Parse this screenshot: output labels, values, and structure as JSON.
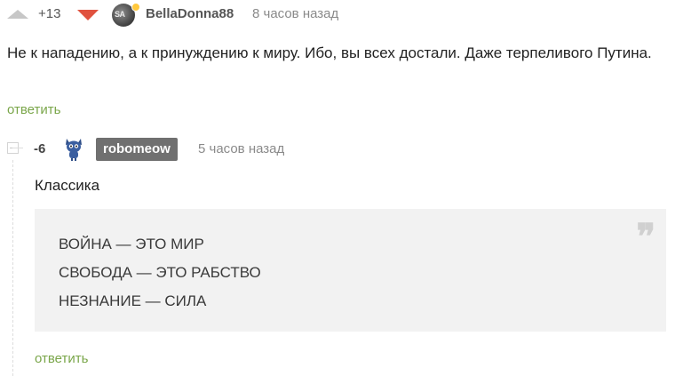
{
  "comment_1": {
    "rating": "+13",
    "username": "BellaDonna88",
    "avatar_text": "SA",
    "time": "8 часов назад",
    "text": "Не к нападению, а к принуждению к миру. Ибо, вы всех достали. Даже терпеливого Путина.",
    "reply_label": "ответить",
    "icons": {
      "upvote": "triangle-up-icon",
      "downvote": "triangle-down-icon"
    },
    "colors": {
      "downvote": "#e0523f",
      "online_dot": "#ffc83d"
    }
  },
  "comment_2": {
    "rating": "-6",
    "username": "robomeow",
    "time": "5 часов назад",
    "text": "Классика",
    "quote_lines": [
      "ВОЙНА — ЭТО МИР",
      "СВОБОДА — ЭТО РАБСТВО",
      "НЕЗНАНИЕ — СИЛА"
    ],
    "quote_icon": "❞",
    "reply_label": "ответить",
    "colors": {
      "username_bg": "#707070",
      "quote_bg": "#f2f2f2"
    }
  },
  "colors": {
    "reply_link": "#7aa64a",
    "muted_text": "#8a8a8a"
  }
}
